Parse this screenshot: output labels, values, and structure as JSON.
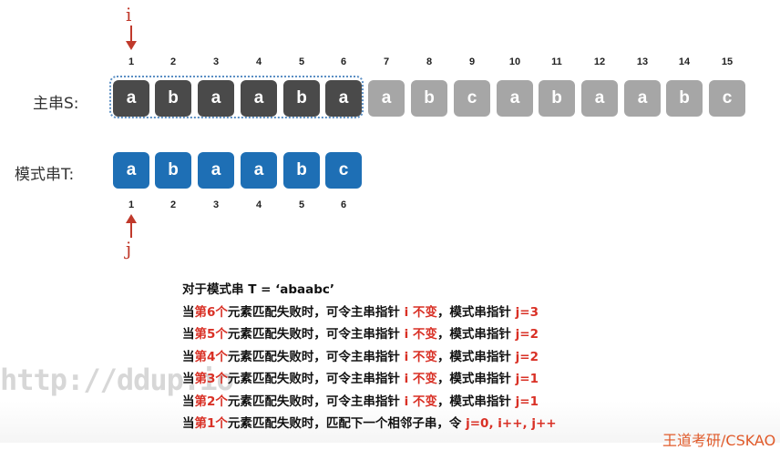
{
  "pointer_i": "i",
  "pointer_j": "j",
  "main_label": "主串S:",
  "pattern_label": "模式串T:",
  "main_indices": [
    "1",
    "2",
    "3",
    "4",
    "5",
    "6",
    "7",
    "8",
    "9",
    "10",
    "11",
    "12",
    "13",
    "14",
    "15"
  ],
  "main_chars": [
    "a",
    "b",
    "a",
    "a",
    "b",
    "a",
    "a",
    "b",
    "c",
    "a",
    "b",
    "a",
    "a",
    "b",
    "c"
  ],
  "pattern_indices": [
    "1",
    "2",
    "3",
    "4",
    "5",
    "6"
  ],
  "pattern_chars": [
    "a",
    "b",
    "a",
    "a",
    "b",
    "c"
  ],
  "colors": {
    "dark": "#4a4a4a",
    "light": "#a6a6a6",
    "pattern": "#1e6fb5",
    "accent": "#d93025"
  },
  "rules": {
    "title": "对于模式串 T = ‘abaabc’",
    "lines": [
      {
        "pre": "当",
        "red": "第6个",
        "mid": "元素匹配失败时，可令主串指针 ",
        "red2": "i 不变",
        "mid2": "，模式串指针 ",
        "red3": "j=3"
      },
      {
        "pre": "当",
        "red": "第5个",
        "mid": "元素匹配失败时，可令主串指针 ",
        "red2": "i 不变",
        "mid2": "，模式串指针 ",
        "red3": "j=2"
      },
      {
        "pre": "当",
        "red": "第4个",
        "mid": "元素匹配失败时，可令主串指针 ",
        "red2": "i 不变",
        "mid2": "，模式串指针 ",
        "red3": "j=2"
      },
      {
        "pre": "当",
        "red": "第3个",
        "mid": "元素匹配失败时，可令主串指针 ",
        "red2": "i 不变",
        "mid2": "，模式串指针 ",
        "red3": "j=1"
      },
      {
        "pre": "当",
        "red": "第2个",
        "mid": "元素匹配失败时，可令主串指针 ",
        "red2": "i 不变",
        "mid2": "，模式串指针 ",
        "red3": "j=1"
      }
    ],
    "last": {
      "pre": "当",
      "red": "第1个",
      "mid": "元素匹配失败时，匹配下一个相邻子串，令 ",
      "red3": "j=0, i++, j++"
    }
  },
  "watermark": "http://ddup.io",
  "corner_text": "王道考研/CSKAO"
}
